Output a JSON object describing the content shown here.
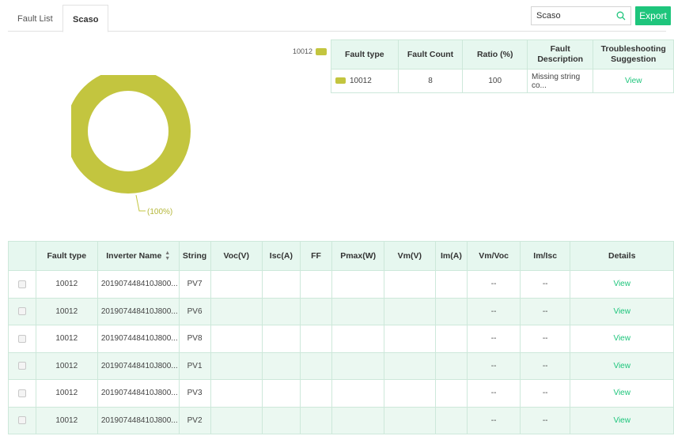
{
  "tabs": [
    {
      "label": "Fault List",
      "active": false
    },
    {
      "label": "Scaso",
      "active": true
    }
  ],
  "search": {
    "value": "Scaso",
    "icon": "search-icon"
  },
  "export_label": "Export",
  "chart_data": {
    "type": "pie",
    "legend": [
      "10012"
    ],
    "slices": [
      {
        "label": "10012",
        "value": 100,
        "color": "#c3c53f"
      }
    ],
    "annotations": [
      "(100%)"
    ]
  },
  "fault_table": {
    "headers": [
      "Fault type",
      "Fault Count",
      "Ratio (%)",
      "Fault Description",
      "Troubleshooting Suggestion"
    ],
    "rows": [
      {
        "type": "10012",
        "count": "8",
        "ratio": "100",
        "description": "Missing string co...",
        "suggestion": "View"
      }
    ]
  },
  "main_table": {
    "headers": [
      "",
      "Fault type",
      "Inverter Name",
      "String",
      "Voc(V)",
      "Isc(A)",
      "FF",
      "Pmax(W)",
      "Vm(V)",
      "Im(A)",
      "Vm/Voc",
      "Im/Isc",
      "Details"
    ],
    "rows": [
      {
        "type": "10012",
        "inverter": "201907448410J800...",
        "string": "PV7",
        "voc": "",
        "isc": "",
        "ff": "",
        "pmax": "",
        "vm": "",
        "im": "",
        "vmvoc": "--",
        "imisc": "--",
        "details": "View"
      },
      {
        "type": "10012",
        "inverter": "201907448410J800...",
        "string": "PV6",
        "voc": "",
        "isc": "",
        "ff": "",
        "pmax": "",
        "vm": "",
        "im": "",
        "vmvoc": "--",
        "imisc": "--",
        "details": "View"
      },
      {
        "type": "10012",
        "inverter": "201907448410J800...",
        "string": "PV8",
        "voc": "",
        "isc": "",
        "ff": "",
        "pmax": "",
        "vm": "",
        "im": "",
        "vmvoc": "--",
        "imisc": "--",
        "details": "View"
      },
      {
        "type": "10012",
        "inverter": "201907448410J800...",
        "string": "PV1",
        "voc": "",
        "isc": "",
        "ff": "",
        "pmax": "",
        "vm": "",
        "im": "",
        "vmvoc": "--",
        "imisc": "--",
        "details": "View"
      },
      {
        "type": "10012",
        "inverter": "201907448410J800...",
        "string": "PV3",
        "voc": "",
        "isc": "",
        "ff": "",
        "pmax": "",
        "vm": "",
        "im": "",
        "vmvoc": "--",
        "imisc": "--",
        "details": "View"
      },
      {
        "type": "10012",
        "inverter": "201907448410J800...",
        "string": "PV2",
        "voc": "",
        "isc": "",
        "ff": "",
        "pmax": "",
        "vm": "",
        "im": "",
        "vmvoc": "--",
        "imisc": "--",
        "details": "View"
      }
    ]
  },
  "colors": {
    "accent": "#1ec57c",
    "slice": "#c3c53f",
    "header_bg": "#e6f7ef",
    "row_alt": "#ebf8f1"
  }
}
